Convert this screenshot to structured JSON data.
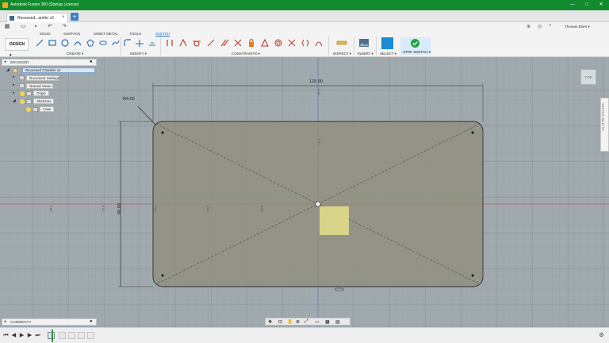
{
  "window": {
    "title": "Autodesk Fusion 360 (Startup License)",
    "controls": [
      "—",
      "□",
      "✕"
    ]
  },
  "doc_tab": {
    "label": "Recessed...amfer v2"
  },
  "user": {
    "name": "Thomas Ebert ▾",
    "help": "?"
  },
  "ribbon": {
    "workspace": "DESIGN ▾",
    "tabs": [
      "SOLID",
      "SURFACE",
      "SHEET METAL",
      "TOOLS",
      "SKETCH"
    ],
    "active_tab": "SKETCH",
    "groups": {
      "create": "CREATE ▾",
      "modify": "MODIFY ▾",
      "constraints": "CONSTRAINTS ▾",
      "inspect": "INSPECT ▾",
      "insert": "INSERT ▾",
      "select": "SELECT ▾",
      "stop_sketch": "STOP SKETCH ▾"
    }
  },
  "browser": {
    "title": "BROWSER",
    "root": "Recessed Chamfer v2",
    "items": [
      "Document Settings",
      "Named Views",
      "Origin",
      "Sketches",
      "Case"
    ]
  },
  "comments": {
    "title": "COMMENTS"
  },
  "viewcube": {
    "label": "TOP"
  },
  "sketch_palette": {
    "label": "SKETCH PALETTE"
  },
  "dimensions": {
    "width": "120.00",
    "height": "60.00",
    "radius": "R4.00",
    "ruler_top": "25.0",
    "ruler_mid": "12.0",
    "left_1": "50.0",
    "left_2": "75.0",
    "left_3": "67.5",
    "left_4": "37.5",
    "left_5": "12.5"
  },
  "colors": {
    "titlebar": "#128a2e",
    "accent": "#1a73c8",
    "sketch_fill": "#8f8e7a",
    "profile_fill": "#e4e08a"
  }
}
